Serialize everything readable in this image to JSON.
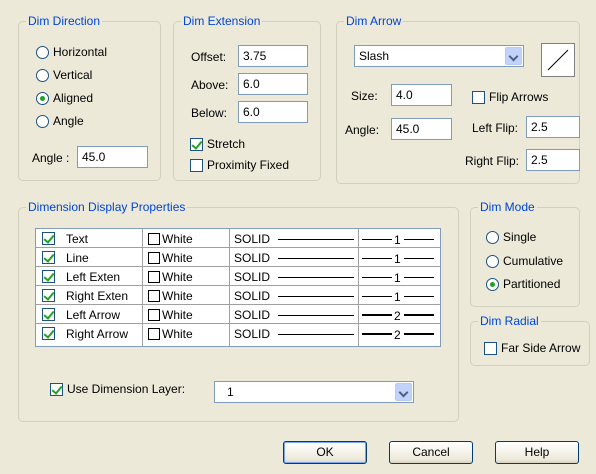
{
  "dim_direction": {
    "title": "Dim Direction",
    "options": [
      {
        "label": "Horizontal",
        "selected": false
      },
      {
        "label": "Vertical",
        "selected": false
      },
      {
        "label": "Aligned",
        "selected": true
      },
      {
        "label": "Angle",
        "selected": false
      }
    ],
    "angle_label": "Angle :",
    "angle_value": "45.0"
  },
  "dim_extension": {
    "title": "Dim Extension",
    "offset_label": "Offset:",
    "offset_value": "3.75",
    "above_label": "Above:",
    "above_value": "6.0",
    "below_label": "Below:",
    "below_value": "6.0",
    "stretch_label": "Stretch",
    "stretch_checked": true,
    "proximity_label": "Proximity Fixed",
    "proximity_checked": false
  },
  "dim_arrow": {
    "title": "Dim Arrow",
    "style_value": "Slash",
    "size_label": "Size:",
    "size_value": "4.0",
    "angle_label": "Angle:",
    "angle_value": "45.0",
    "flip_label": "Flip Arrows",
    "flip_checked": false,
    "left_flip_label": "Left Flip:",
    "left_flip_value": "2.5",
    "right_flip_label": "Right Flip:",
    "right_flip_value": "2.5"
  },
  "display_props": {
    "title": "Dimension Display Properties",
    "rows": [
      {
        "name": "Text",
        "checked": true,
        "color": "White",
        "linetype": "SOLID",
        "weight": "1"
      },
      {
        "name": "Line",
        "checked": true,
        "color": "White",
        "linetype": "SOLID",
        "weight": "1"
      },
      {
        "name": "Left Exten",
        "checked": true,
        "color": "White",
        "linetype": "SOLID",
        "weight": "1"
      },
      {
        "name": "Right Exten",
        "checked": true,
        "color": "White",
        "linetype": "SOLID",
        "weight": "1"
      },
      {
        "name": "Left Arrow",
        "checked": true,
        "color": "White",
        "linetype": "SOLID",
        "weight": "2"
      },
      {
        "name": "Right Arrow",
        "checked": true,
        "color": "White",
        "linetype": "SOLID",
        "weight": "2"
      }
    ],
    "use_layer_label": "Use Dimension Layer:",
    "use_layer_checked": true,
    "layer_value": "1"
  },
  "dim_mode": {
    "title": "Dim Mode",
    "options": [
      {
        "label": "Single",
        "selected": false
      },
      {
        "label": "Cumulative",
        "selected": false
      },
      {
        "label": "Partitioned",
        "selected": true
      }
    ]
  },
  "dim_radial": {
    "title": "Dim Radial",
    "far_side_label": "Far Side Arrow",
    "far_side_checked": false
  },
  "buttons": {
    "ok": "OK",
    "cancel": "Cancel",
    "help": "Help"
  },
  "colors": {
    "legend": "#0046d5",
    "check": "#21a121",
    "dialog_bg": "#ece9d8"
  }
}
